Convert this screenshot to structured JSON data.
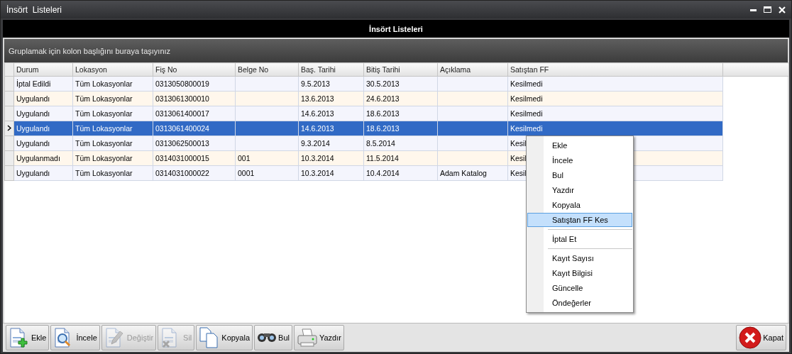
{
  "window": {
    "title": "İnsört  Listeleri"
  },
  "panel_title": "İnsört Listeleri",
  "group_hint": "Gruplamak için kolon başlığını buraya taşıyınız",
  "table": {
    "columns": [
      "Durum",
      "Lokasyon",
      "Fiş No",
      "Belge No",
      "Baş. Tarihi",
      "Bitiş Tarihi",
      "Açıklama",
      "Satıştan FF"
    ],
    "rows": [
      {
        "cells": [
          "İptal Edildi",
          "Tüm Lokasyonlar",
          "0313050800019",
          "",
          "9.5.2013",
          "30.5.2013",
          "",
          "Kesilmedi"
        ],
        "selected": false
      },
      {
        "cells": [
          "Uygulandı",
          "Tüm Lokasyonlar",
          "0313061300010",
          "",
          "13.6.2013",
          "24.6.2013",
          "",
          "Kesilmedi"
        ],
        "selected": false
      },
      {
        "cells": [
          "Uygulandı",
          "Tüm Lokasyonlar",
          "0313061400017",
          "",
          "14.6.2013",
          "18.6.2013",
          "",
          "Kesilmedi"
        ],
        "selected": false
      },
      {
        "cells": [
          "Uygulandı",
          "Tüm Lokasyonlar",
          "0313061400024",
          "",
          "14.6.2013",
          "18.6.2013",
          "",
          "Kesilmedi"
        ],
        "selected": true
      },
      {
        "cells": [
          "Uygulandı",
          "Tüm Lokasyonlar",
          "0313062500013",
          "",
          "9.3.2014",
          "8.5.2014",
          "",
          "Kesil"
        ],
        "selected": false
      },
      {
        "cells": [
          "Uygulanmadı",
          "Tüm Lokasyonlar",
          "0314031000015",
          "001",
          "10.3.2014",
          "11.5.2014",
          "",
          "Kesil"
        ],
        "selected": false
      },
      {
        "cells": [
          "Uygulandı",
          "Tüm Lokasyonlar",
          "0314031000022",
          "0001",
          "10.3.2014",
          "10.4.2014",
          "Adam Katalog",
          "Kesil"
        ],
        "selected": false
      }
    ]
  },
  "context_menu": [
    {
      "label": "Ekle",
      "selected": false,
      "divider_before": false
    },
    {
      "label": "İncele",
      "selected": false,
      "divider_before": false
    },
    {
      "label": "Bul",
      "selected": false,
      "divider_before": false
    },
    {
      "label": "Yazdır",
      "selected": false,
      "divider_before": false
    },
    {
      "label": "Kopyala",
      "selected": false,
      "divider_before": false
    },
    {
      "label": "Satıştan FF Kes",
      "selected": true,
      "divider_before": false
    },
    {
      "label": "İptal Et",
      "selected": false,
      "divider_before": true
    },
    {
      "label": "Kayıt Sayısı",
      "selected": false,
      "divider_before": true
    },
    {
      "label": "Kayıt Bilgisi",
      "selected": false,
      "divider_before": false
    },
    {
      "label": "Güncelle",
      "selected": false,
      "divider_before": false
    },
    {
      "label": "Öndeğerler",
      "selected": false,
      "divider_before": false
    }
  ],
  "toolbar": [
    {
      "label": "Ekle",
      "kind": "add",
      "disabled": false
    },
    {
      "label": "İncele",
      "kind": "inspect",
      "disabled": false
    },
    {
      "label": "Değiştir",
      "kind": "edit",
      "disabled": true
    },
    {
      "label": "Sil",
      "kind": "delete",
      "disabled": true
    },
    {
      "label": "Kopyala",
      "kind": "copy",
      "disabled": false
    },
    {
      "label": "Bul",
      "kind": "find",
      "disabled": false
    },
    {
      "label": "Yazdır",
      "kind": "print",
      "disabled": false
    }
  ],
  "close_button": {
    "label": "Kapat"
  }
}
